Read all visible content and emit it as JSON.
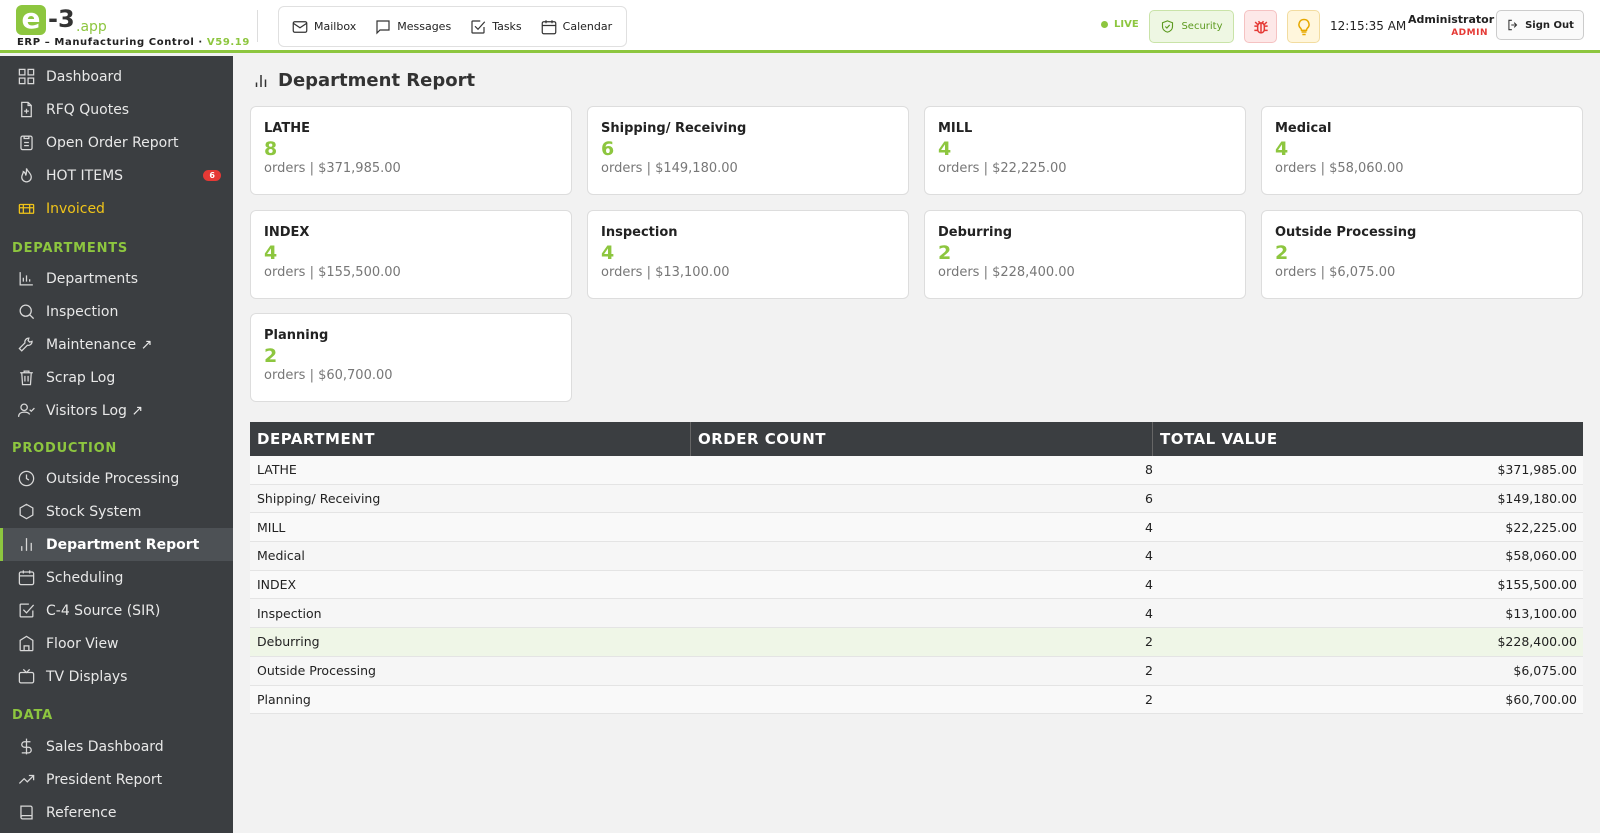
{
  "brand": {
    "logo_letter": "e",
    "logo_number": "-3",
    "logo_suffix": ".app",
    "subtitle": "ERP – Manufacturing Control ·",
    "version": "V59.19",
    "accent_color": "#8dc63f"
  },
  "topnav": [
    {
      "label": "Mailbox",
      "icon": "mail-icon"
    },
    {
      "label": "Messages",
      "icon": "message-icon"
    },
    {
      "label": "Tasks",
      "icon": "checkbox-icon"
    },
    {
      "label": "Calendar",
      "icon": "calendar-icon"
    }
  ],
  "header": {
    "live_label": "LIVE",
    "security_label": "Security",
    "time": "12:15:35 AM",
    "user_name": "Administrator",
    "user_role": "ADMIN",
    "signout_label": "Sign Out"
  },
  "sidebar": {
    "items_top": [
      {
        "label": "Dashboard",
        "icon": "grid-icon"
      },
      {
        "label": "RFQ Quotes",
        "icon": "file-plus-icon"
      },
      {
        "label": "Open Order Report",
        "icon": "clipboard-icon"
      },
      {
        "label": "HOT ITEMS",
        "icon": "flame-icon",
        "badge": "6"
      },
      {
        "label": "Invoiced",
        "icon": "ticket-icon"
      }
    ],
    "section_departments": "DEPARTMENTS",
    "items_departments": [
      {
        "label": "Departments",
        "icon": "chart-icon"
      },
      {
        "label": "Inspection",
        "icon": "magnifier-icon"
      },
      {
        "label": "Maintenance ↗",
        "icon": "wrench-icon"
      },
      {
        "label": "Scrap Log",
        "icon": "trash-icon"
      },
      {
        "label": "Visitors Log ↗",
        "icon": "user-check-icon"
      }
    ],
    "section_production": "PRODUCTION",
    "items_production": [
      {
        "label": "Outside Processing",
        "icon": "clock-icon"
      },
      {
        "label": "Stock System",
        "icon": "hexagon-icon"
      },
      {
        "label": "Department Report",
        "icon": "bar-chart-icon"
      },
      {
        "label": "Scheduling",
        "icon": "calendar-icon"
      },
      {
        "label": "C-4 Source (SIR)",
        "icon": "check-square-icon"
      },
      {
        "label": "Floor View",
        "icon": "building-icon"
      },
      {
        "label": "TV Displays",
        "icon": "tv-icon"
      }
    ],
    "section_data": "DATA",
    "items_data": [
      {
        "label": "Sales Dashboard",
        "icon": "dollar-icon"
      },
      {
        "label": "President Report",
        "icon": "trending-icon"
      },
      {
        "label": "Reference",
        "icon": "book-icon"
      }
    ]
  },
  "page": {
    "title": "Department Report"
  },
  "cards": [
    {
      "name": "LATHE",
      "count": "8",
      "sub": "orders | $371,985.00"
    },
    {
      "name": "Shipping/ Receiving",
      "count": "6",
      "sub": "orders | $149,180.00"
    },
    {
      "name": "MILL",
      "count": "4",
      "sub": "orders | $22,225.00"
    },
    {
      "name": "Medical",
      "count": "4",
      "sub": "orders | $58,060.00"
    },
    {
      "name": "INDEX",
      "count": "4",
      "sub": "orders | $155,500.00"
    },
    {
      "name": "Inspection",
      "count": "4",
      "sub": "orders | $13,100.00"
    },
    {
      "name": "Deburring",
      "count": "2",
      "sub": "orders | $228,400.00"
    },
    {
      "name": "Outside Processing",
      "count": "2",
      "sub": "orders | $6,075.00"
    },
    {
      "name": "Planning",
      "count": "2",
      "sub": "orders | $60,700.00"
    }
  ],
  "table": {
    "headers": [
      "DEPARTMENT",
      "ORDER COUNT",
      "TOTAL VALUE"
    ],
    "rows": [
      [
        "LATHE",
        "8",
        "$371,985.00"
      ],
      [
        "Shipping/ Receiving",
        "6",
        "$149,180.00"
      ],
      [
        "MILL",
        "4",
        "$22,225.00"
      ],
      [
        "Medical",
        "4",
        "$58,060.00"
      ],
      [
        "INDEX",
        "4",
        "$155,500.00"
      ],
      [
        "Inspection",
        "4",
        "$13,100.00"
      ],
      [
        "Deburring",
        "2",
        "$228,400.00"
      ],
      [
        "Outside Processing",
        "2",
        "$6,075.00"
      ],
      [
        "Planning",
        "2",
        "$60,700.00"
      ]
    ]
  }
}
